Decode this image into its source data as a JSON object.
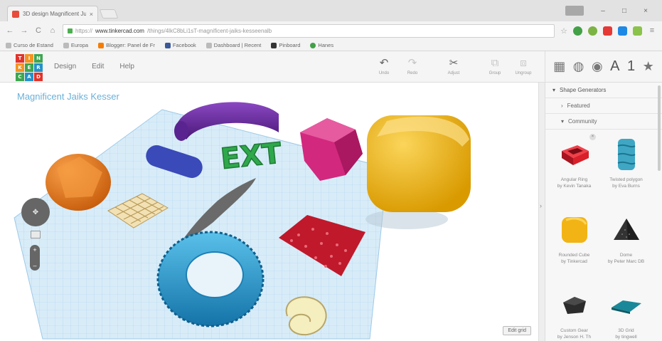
{
  "browser": {
    "tab_title": "3D design Magnificent Ju...",
    "tab_close": "×",
    "window_controls": [
      "–",
      "□",
      "×"
    ],
    "url_prefix": "https://",
    "url_domain": "www.tinkercad.com",
    "url_path": "/things/4lkC8bLi1sT-magnificent-jaiks-kesseenalb",
    "bookmarks": [
      "Curso de Estand",
      "Europa",
      "Blogger: Panel de Fr",
      "Facebook",
      "Dashboard | Recent",
      "Pinboard",
      "Hanes"
    ]
  },
  "app": {
    "logo_letters": [
      "TIN",
      "KER",
      "CAD"
    ],
    "menu": [
      "Design",
      "Edit",
      "Help"
    ],
    "tools": [
      {
        "icon": "↶",
        "label": "Undo",
        "enabled": true
      },
      {
        "icon": "↷",
        "label": "Redo",
        "enabled": false
      },
      {
        "icon": "✂",
        "label": "Adjust",
        "enabled": true
      },
      {
        "icon": "⧉",
        "label": "Group",
        "enabled": false
      },
      {
        "icon": "⧈",
        "label": "Ungroup",
        "enabled": false
      }
    ],
    "right_toolbar": [
      "▦",
      "◍",
      "◉",
      "A",
      "1",
      "★"
    ],
    "design_title": "Magnificent Jaiks Kesser",
    "edit_grid": "Edit grid"
  },
  "sidebar": {
    "sections": [
      {
        "label": "Shape Generators",
        "level": 0,
        "expanded": true
      },
      {
        "label": "Featured",
        "level": 1,
        "expanded": false
      },
      {
        "label": "Community",
        "level": 1,
        "expanded": true
      }
    ],
    "shapes": [
      {
        "caption1": "Angular Ring",
        "caption2": "by Kevin Tanaka",
        "icon": "red-box-icon",
        "color": "#d9202a",
        "badge": "×"
      },
      {
        "caption1": "Twisted polygon",
        "caption2": "by Eva Burns",
        "icon": "twisted-prism-icon",
        "color": "#3fa7c4",
        "badge": ""
      },
      {
        "caption1": "Rounded Cube",
        "caption2": "by Tinkercad",
        "icon": "rounded-cube-icon",
        "color": "#f2b415",
        "badge": ""
      },
      {
        "caption1": "Dome",
        "caption2": "by Peter Marc DB",
        "icon": "dome-icon",
        "color": "#333333",
        "badge": ""
      },
      {
        "caption1": "Custom Gear",
        "caption2": "by Jenson H. Th",
        "icon": "pentagon-icon",
        "color": "#2c2c2c",
        "badge": ""
      },
      {
        "caption1": "3D Grid",
        "caption2": "by tingwell",
        "icon": "plate-icon",
        "color": "#1a8899",
        "badge": ""
      }
    ]
  },
  "colors": {
    "purple": "#6a2aa0",
    "green": "#2ea84b",
    "magenta": "#d2287e",
    "yellow": "#f2b415",
    "orange": "#f08020",
    "blue": "#3a4ab8",
    "gray": "#6a6a6a",
    "cyan": "#2592c8",
    "red": "#c0192b",
    "cream": "#f5eebe",
    "grid": "#cfe6f5"
  }
}
